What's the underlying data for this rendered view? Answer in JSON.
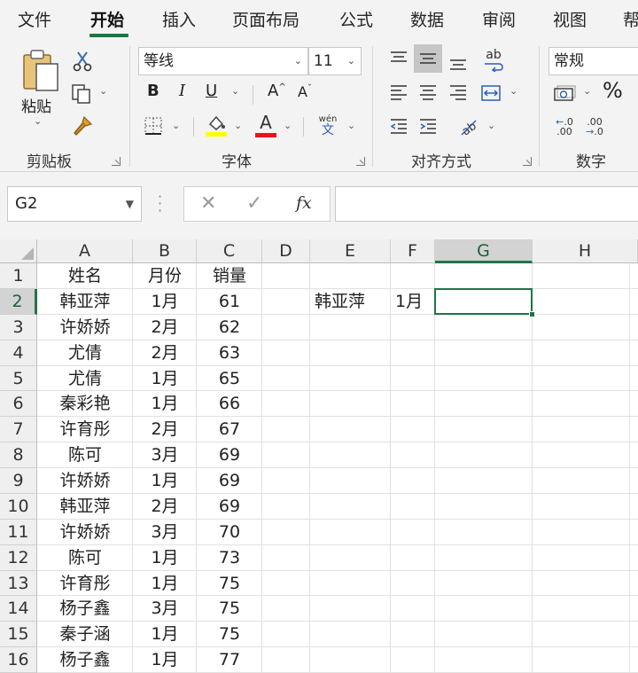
{
  "menu": {
    "tabs": [
      "文件",
      "开始",
      "插入",
      "页面布局",
      "公式",
      "数据",
      "审阅",
      "视图",
      "帮"
    ],
    "active": "开始"
  },
  "ribbon": {
    "clipboard": {
      "paste_label": "粘贴",
      "group_label": "剪贴板"
    },
    "font": {
      "font_name": "等线",
      "font_size": "11",
      "group_label": "字体",
      "bold": "B",
      "italic": "I",
      "underline": "U",
      "grow": "A",
      "shrink": "A",
      "font_color_glyph": "A",
      "highlight_color": "#ffff00",
      "font_color": "#e81123",
      "phonetic_top": "wén",
      "phonetic_bottom": "文"
    },
    "alignment": {
      "group_label": "对齐方式",
      "wrap_glyph": "ab"
    },
    "number": {
      "format": "常规",
      "group_label": "数字",
      "percent": "%",
      "inc_decimal": ".0",
      "dec_decimal": ".00"
    }
  },
  "formula_bar": {
    "name_box": "G2",
    "fx_label": "fx",
    "formula": ""
  },
  "sheet": {
    "columns": [
      "A",
      "B",
      "C",
      "D",
      "E",
      "F",
      "G",
      "H"
    ],
    "rows": [
      "1",
      "2",
      "3",
      "4",
      "5",
      "6",
      "7",
      "8",
      "9",
      "10",
      "11",
      "12",
      "13",
      "14",
      "15",
      "16"
    ],
    "selected_cell": "G2",
    "data": [
      [
        "姓名",
        "月份",
        "销量"
      ],
      [
        "韩亚萍",
        "1月",
        "61"
      ],
      [
        "许娇娇",
        "2月",
        "62"
      ],
      [
        "尤倩",
        "2月",
        "63"
      ],
      [
        "尤倩",
        "1月",
        "65"
      ],
      [
        "秦彩艳",
        "1月",
        "66"
      ],
      [
        "许育彤",
        "2月",
        "67"
      ],
      [
        "陈可",
        "3月",
        "69"
      ],
      [
        "许娇娇",
        "1月",
        "69"
      ],
      [
        "韩亚萍",
        "2月",
        "69"
      ],
      [
        "许娇娇",
        "3月",
        "70"
      ],
      [
        "陈可",
        "1月",
        "73"
      ],
      [
        "许育彤",
        "1月",
        "75"
      ],
      [
        "杨子鑫",
        "3月",
        "75"
      ],
      [
        "秦子涵",
        "1月",
        "75"
      ],
      [
        "杨子鑫",
        "1月",
        "77"
      ]
    ],
    "lookup": {
      "name": "韩亚萍",
      "month": "1月"
    }
  }
}
